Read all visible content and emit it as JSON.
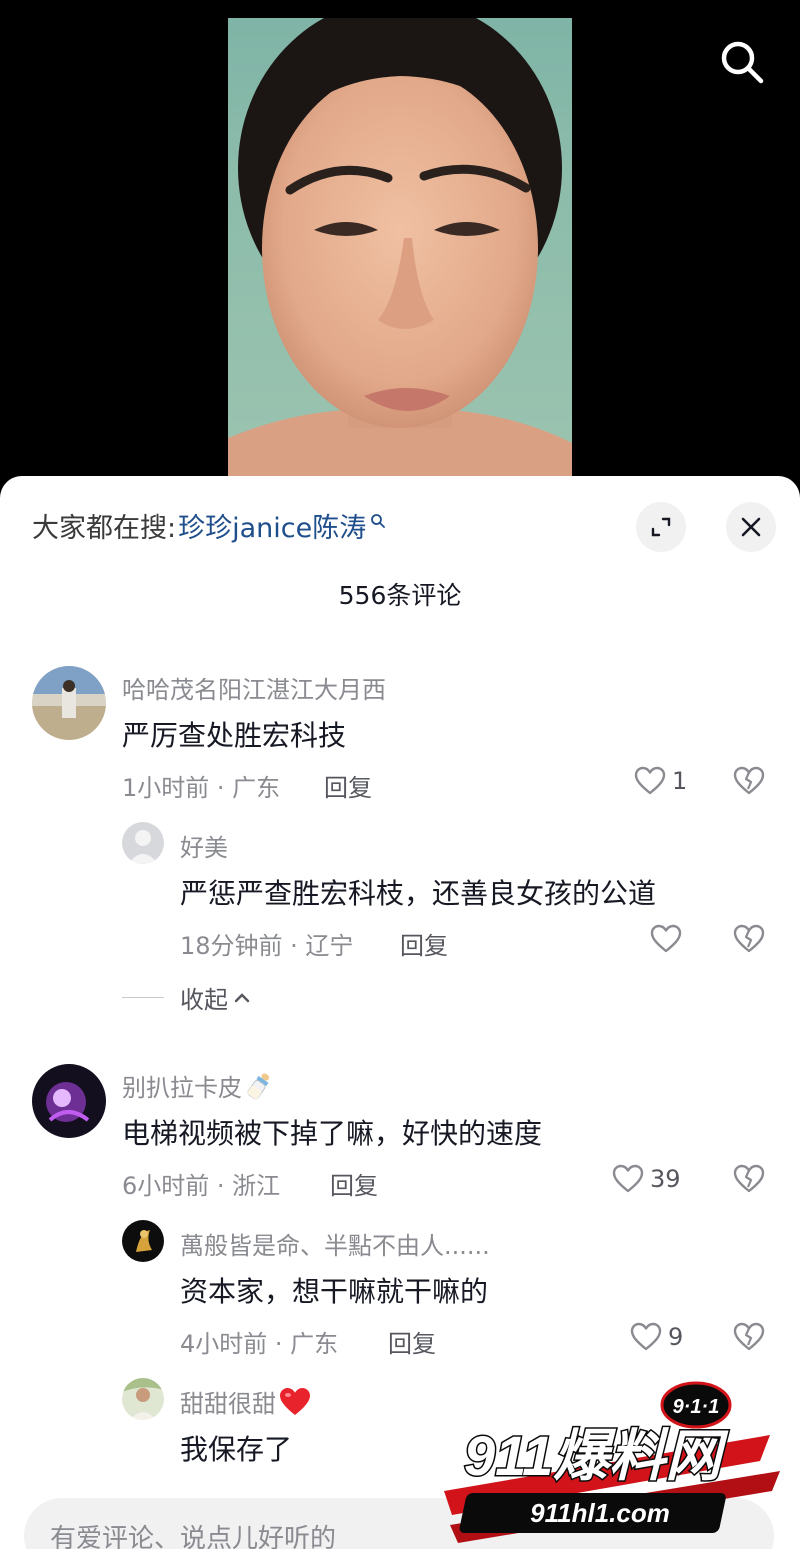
{
  "search": {
    "icon": "search-icon"
  },
  "sheet": {
    "trending_label": "大家都在搜:",
    "trending_term": "珍珍janice陈涛",
    "comment_count_label": "556条评论"
  },
  "comments": [
    {
      "name": "哈哈茂名阳江湛江大月西",
      "text": "严厉查处胜宏科技",
      "meta": "1小时前 · 广东",
      "reply": "回复",
      "likes": "1",
      "replies": [
        {
          "name": "好美",
          "text": "严惩严查胜宏科枝，还善良女孩的公道",
          "meta": "18分钟前 · 辽宁",
          "reply": "回复",
          "likes": ""
        }
      ],
      "collapse": "收起"
    },
    {
      "name": "别扒拉卡皮",
      "text": "电梯视频被下掉了嘛，好快的速度",
      "meta": "6小时前 · 浙江",
      "reply": "回复",
      "likes": "39",
      "replies": [
        {
          "name": "萬般皆是命、半點不由人......",
          "text": "资本家，想干嘛就干嘛的",
          "meta": "4小时前 · 广东",
          "reply": "回复",
          "likes": "9"
        },
        {
          "name": "甜甜很甜",
          "text": "我保存了"
        }
      ]
    }
  ],
  "input": {
    "placeholder": "有爱评论、说点儿好听的"
  },
  "watermark": {
    "top": "9·1·1",
    "brand": "911爆料网",
    "url": "911hl1.com"
  },
  "colors": {
    "accent_link": "#1f4e8c",
    "watermark_red": "#d2141a",
    "heart_red": "#e8232b"
  }
}
